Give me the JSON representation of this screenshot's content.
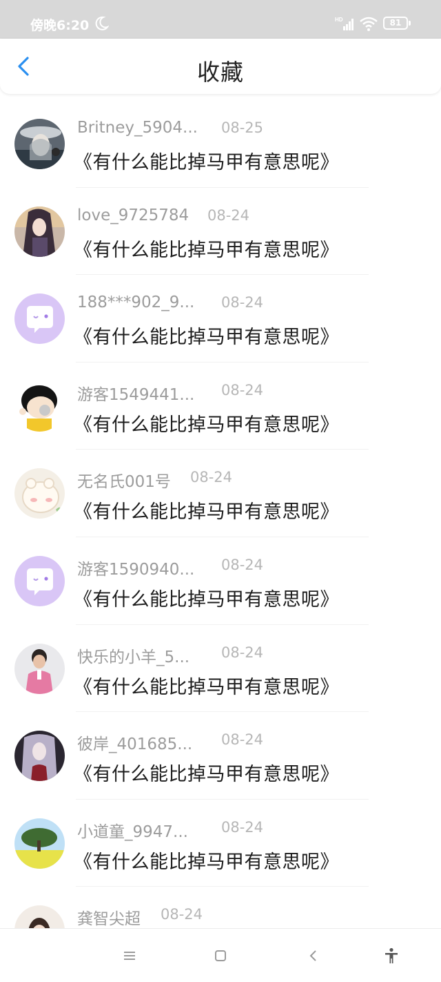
{
  "status_bar": {
    "time": "傍晚6:20",
    "battery": "81",
    "icons": [
      "moon-icon",
      "signal-icon",
      "wifi-icon",
      "battery-icon"
    ]
  },
  "nav": {
    "title": "收藏",
    "back_icon": "chevron-left-icon"
  },
  "items": [
    {
      "name": "Britney_5904...",
      "date": "08-25",
      "title": "《有什么能比掉马甲有意思呢》"
    },
    {
      "name": "love_9725784",
      "date": "08-24",
      "title": "《有什么能比掉马甲有意思呢》"
    },
    {
      "name": "188***902_9...",
      "date": "08-24",
      "title": "《有什么能比掉马甲有意思呢》"
    },
    {
      "name": "游客1549441...",
      "date": "08-24",
      "title": "《有什么能比掉马甲有意思呢》"
    },
    {
      "name": "无名氏001号",
      "date": "08-24",
      "title": "《有什么能比掉马甲有意思呢》"
    },
    {
      "name": "游客1590940...",
      "date": "08-24",
      "title": "《有什么能比掉马甲有意思呢》"
    },
    {
      "name": "快乐的小羊_5...",
      "date": "08-24",
      "title": "《有什么能比掉马甲有意思呢》"
    },
    {
      "name": "彼岸_401685...",
      "date": "08-24",
      "title": "《有什么能比掉马甲有意思呢》"
    },
    {
      "name": "小道童_9947...",
      "date": "08-24",
      "title": "《有什么能比掉马甲有意思呢》"
    },
    {
      "name": "龚智尖超",
      "date": "08-24",
      "title": ""
    }
  ],
  "bottom_nav": [
    "menu-icon",
    "home-square-icon",
    "back-chevron-icon",
    "accessibility-icon"
  ],
  "colors": {
    "accent_blue": "#2a8ff0",
    "default_avatar": "#d9c6f6",
    "name_gray": "#9c9c9c",
    "date_gray": "#b6b6b6",
    "title_dark": "#1d1d1d"
  }
}
